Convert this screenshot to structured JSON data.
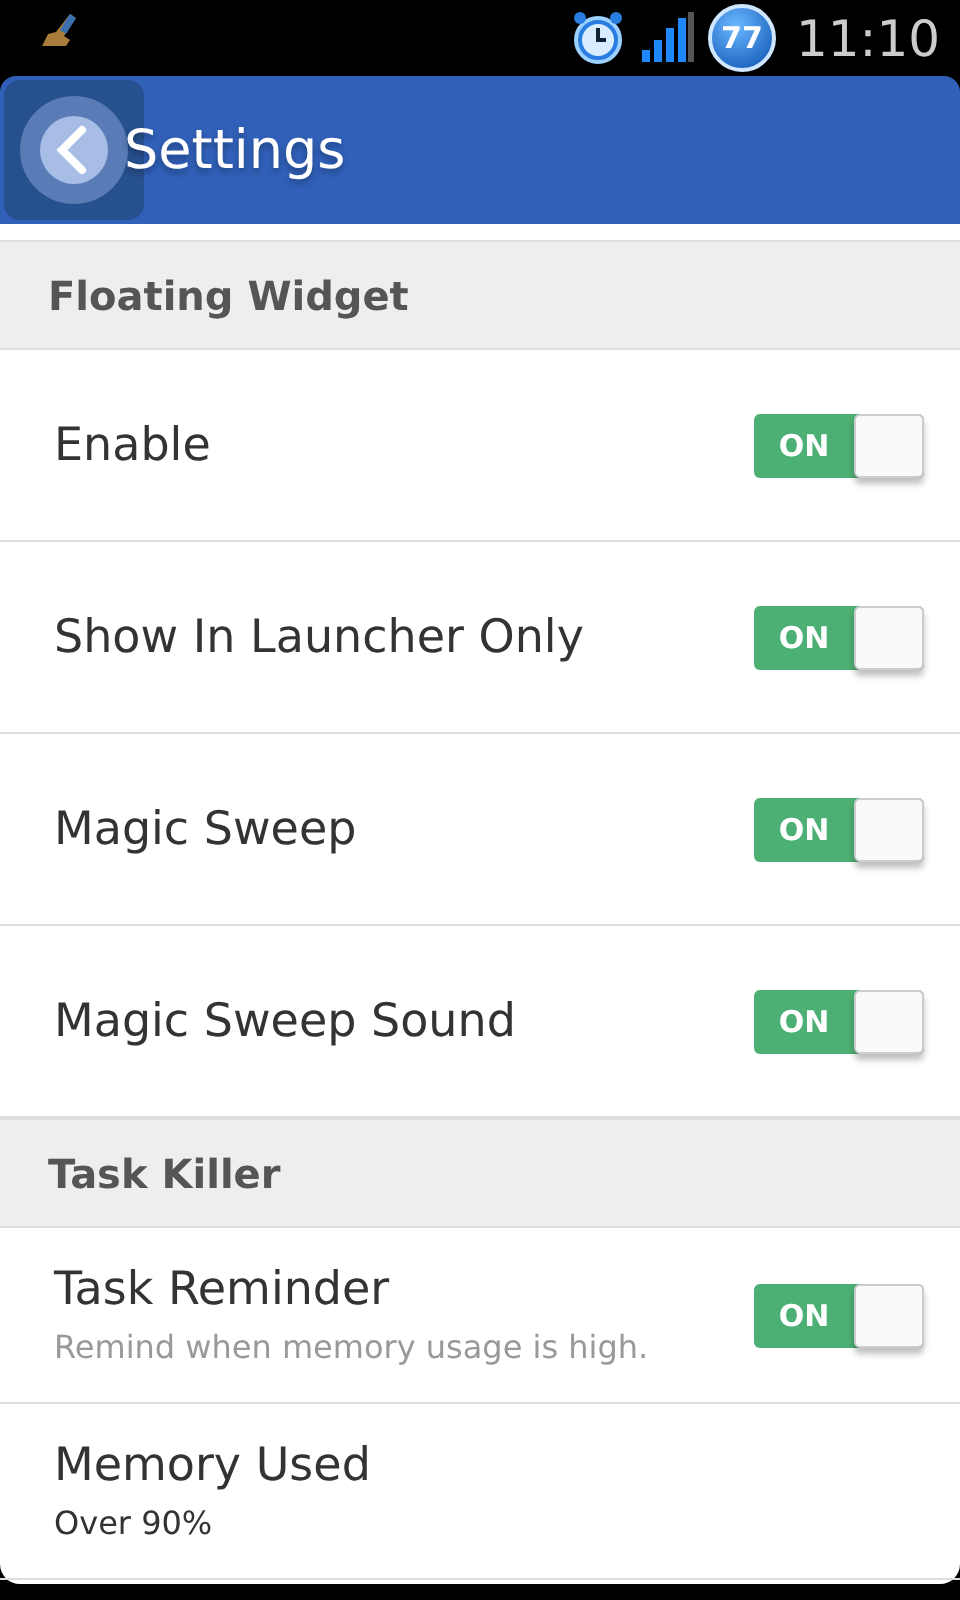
{
  "status_bar": {
    "time": "11:10",
    "badge": "77"
  },
  "header": {
    "title": "Settings"
  },
  "sections": [
    {
      "title": "Floating Widget",
      "items": [
        {
          "kind": "toggle",
          "label": "Enable",
          "on": true,
          "switch_text": "ON"
        },
        {
          "kind": "toggle",
          "label": "Show In Launcher Only",
          "on": true,
          "switch_text": "ON"
        },
        {
          "kind": "toggle",
          "label": "Magic Sweep",
          "on": true,
          "switch_text": "ON"
        },
        {
          "kind": "toggle",
          "label": "Magic Sweep Sound",
          "on": true,
          "switch_text": "ON"
        }
      ]
    },
    {
      "title": "Task Killer",
      "items": [
        {
          "kind": "toggle",
          "label": "Task Reminder",
          "summary": "Remind when memory usage is high.",
          "on": true,
          "switch_text": "ON"
        },
        {
          "kind": "value",
          "label": "Memory Used",
          "value": "Over 90%"
        }
      ]
    }
  ]
}
